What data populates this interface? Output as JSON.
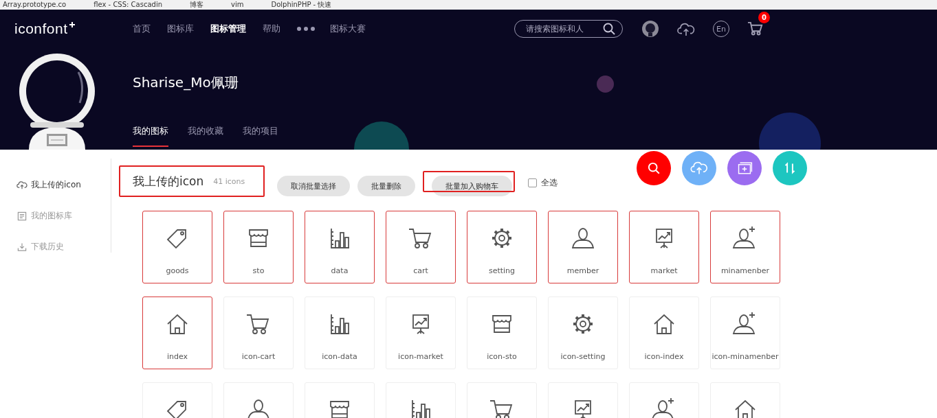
{
  "bookmarks": [
    "Array.prototype.co",
    "flex - CSS: Cascadin",
    "博客",
    "vim",
    "DolphinPHP - 快速"
  ],
  "logo": "iconfont",
  "nav": [
    {
      "label": "首页",
      "selected": false
    },
    {
      "label": "图标库",
      "selected": false
    },
    {
      "label": "图标管理",
      "selected": true
    },
    {
      "label": "帮助",
      "selected": false
    },
    {
      "label": "图标大赛",
      "selected": false
    }
  ],
  "search": {
    "placeholder": "请搜索图标和人"
  },
  "language_button": "En",
  "cart_badge": "0",
  "profile": {
    "name": "Sharise_Mo佩珊"
  },
  "profile_tabs": [
    {
      "label": "我的图标",
      "selected": true
    },
    {
      "label": "我的收藏",
      "selected": false
    },
    {
      "label": "我的项目",
      "selected": false
    }
  ],
  "action_buttons": [
    {
      "kind": "search",
      "color": "#ff0000"
    },
    {
      "kind": "upload",
      "color": "#6fb1f7"
    },
    {
      "kind": "album",
      "color": "#9b6cf0"
    },
    {
      "kind": "sort",
      "color": "#1dc6c0"
    }
  ],
  "sidebar": {
    "items": [
      {
        "kind": "upload",
        "label": "我上传的icon",
        "selected": true
      },
      {
        "kind": "library",
        "label": "我的图标库",
        "selected": false
      },
      {
        "kind": "download",
        "label": "下载历史",
        "selected": false
      }
    ]
  },
  "section": {
    "title": "我上传的icon",
    "count": "41 icons",
    "highlighted": true
  },
  "toolbar_buttons": [
    {
      "label": "取消批量选择",
      "highlighted": false
    },
    {
      "label": "批量删除",
      "highlighted": false
    },
    {
      "label": "批量加入购物车",
      "highlighted": true
    }
  ],
  "select_all": {
    "label": "全选",
    "checked": false
  },
  "icons": [
    {
      "kind": "tag",
      "label": "goods",
      "selected": true
    },
    {
      "kind": "store",
      "label": "sto",
      "selected": true
    },
    {
      "kind": "chart",
      "label": "data",
      "selected": true
    },
    {
      "kind": "cart",
      "label": "cart",
      "selected": true
    },
    {
      "kind": "gear",
      "label": "setting",
      "selected": true
    },
    {
      "kind": "person",
      "label": "member",
      "selected": true
    },
    {
      "kind": "board",
      "label": "market",
      "selected": true
    },
    {
      "kind": "person-plus",
      "label": "minamenber",
      "selected": true
    },
    {
      "kind": "house",
      "label": "index",
      "selected": true
    },
    {
      "kind": "cart",
      "label": "icon-cart",
      "selected": false
    },
    {
      "kind": "chart",
      "label": "icon-data",
      "selected": false
    },
    {
      "kind": "board",
      "label": "icon-market",
      "selected": false
    },
    {
      "kind": "store",
      "label": "icon-sto",
      "selected": false
    },
    {
      "kind": "gear",
      "label": "icon-setting",
      "selected": false
    },
    {
      "kind": "house",
      "label": "icon-index",
      "selected": false
    },
    {
      "kind": "person-plus",
      "label": "icon-minamenber",
      "selected": false
    },
    {
      "kind": "tag",
      "selected": false
    },
    {
      "kind": "person",
      "selected": false
    },
    {
      "kind": "store",
      "selected": false
    },
    {
      "kind": "chart",
      "selected": false
    },
    {
      "kind": "cart",
      "selected": false
    },
    {
      "kind": "board",
      "selected": false
    },
    {
      "kind": "person-plus",
      "selected": false
    },
    {
      "kind": "house",
      "selected": false
    }
  ]
}
